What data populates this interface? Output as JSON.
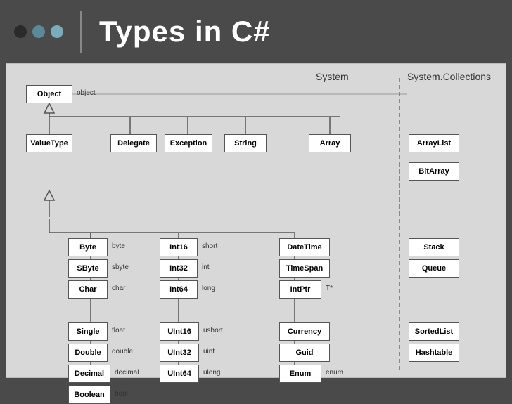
{
  "header": {
    "title": "Types in C#",
    "dots": [
      "dark",
      "mid",
      "light"
    ]
  },
  "diagram": {
    "section_system": "System",
    "section_collections": "System.Collections",
    "boxes": {
      "Object": {
        "label": "Object",
        "alias": "object"
      },
      "ValueType": {
        "label": "ValueType"
      },
      "Delegate": {
        "label": "Delegate"
      },
      "Exception": {
        "label": "Exception"
      },
      "String": {
        "label": "String"
      },
      "Array": {
        "label": "Array"
      },
      "Byte": {
        "label": "Byte",
        "alias": "byte"
      },
      "SByte": {
        "label": "SByte",
        "alias": "sbyte"
      },
      "Char": {
        "label": "Char",
        "alias": "char"
      },
      "Single": {
        "label": "Single",
        "alias": "float"
      },
      "Double": {
        "label": "Double",
        "alias": "double"
      },
      "Decimal": {
        "label": "Decimal",
        "alias": "decimal"
      },
      "Boolean": {
        "label": "Boolean",
        "alias": "bool"
      },
      "Int16": {
        "label": "Int16",
        "alias": "short"
      },
      "Int32": {
        "label": "Int32",
        "alias": "int"
      },
      "Int64": {
        "label": "Int64",
        "alias": "long"
      },
      "UInt16": {
        "label": "UInt16",
        "alias": "ushort"
      },
      "UInt32": {
        "label": "UInt32",
        "alias": "uint"
      },
      "UInt64": {
        "label": "UInt64",
        "alias": "ulong"
      },
      "DateTime": {
        "label": "DateTime"
      },
      "TimeSpan": {
        "label": "TimeSpan"
      },
      "IntPtr": {
        "label": "IntPtr",
        "alias": "T*"
      },
      "Currency": {
        "label": "Currency"
      },
      "Guid": {
        "label": "Guid"
      },
      "Enum": {
        "label": "Enum",
        "alias": "enum"
      },
      "ArrayList": {
        "label": "ArrayList"
      },
      "BitArray": {
        "label": "BitArray"
      },
      "Stack": {
        "label": "Stack"
      },
      "Queue": {
        "label": "Queue"
      },
      "SortedList": {
        "label": "SortedList"
      },
      "Hashtable": {
        "label": "Hashtable"
      }
    }
  }
}
